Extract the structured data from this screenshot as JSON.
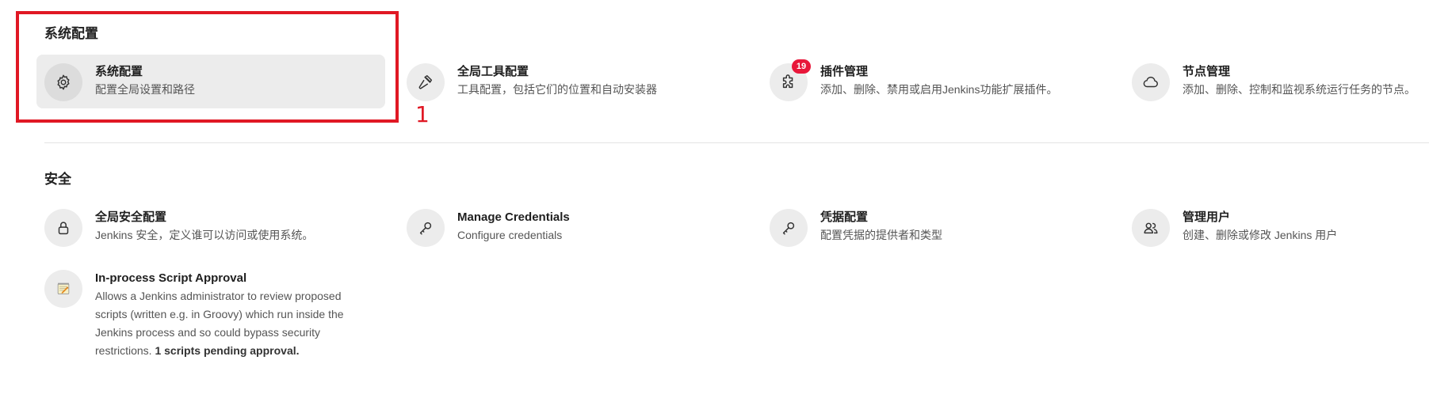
{
  "sections": {
    "system": {
      "title": "系统配置"
    },
    "security": {
      "title": "安全"
    }
  },
  "items": {
    "system_config": {
      "title": "系统配置",
      "desc": "配置全局设置和路径",
      "icon": "gear-icon"
    },
    "global_tools": {
      "title": "全局工具配置",
      "desc": "工具配置，包括它们的位置和自动安装器",
      "icon": "hammer-icon"
    },
    "plugins": {
      "title": "插件管理",
      "desc": "添加、删除、禁用或启用Jenkins功能扩展插件。",
      "icon": "puzzle-icon",
      "badge": "19"
    },
    "nodes": {
      "title": "节点管理",
      "desc": "添加、删除、控制和监视系统运行任务的节点。",
      "icon": "cloud-icon"
    },
    "global_security": {
      "title": "全局安全配置",
      "desc": "Jenkins 安全，定义谁可以访问或使用系统。",
      "icon": "lock-icon"
    },
    "manage_credentials": {
      "title": "Manage Credentials",
      "desc": "Configure credentials",
      "icon": "key-icon"
    },
    "credential_config": {
      "title": "凭据配置",
      "desc": "配置凭据的提供者和类型",
      "icon": "key-icon"
    },
    "manage_users": {
      "title": "管理用户",
      "desc": "创建、删除或修改 Jenkins 用户",
      "icon": "users-icon"
    },
    "script_approval": {
      "title": "In-process Script Approval",
      "desc": "Allows a Jenkins administrator to review proposed scripts (written e.g. in Groovy) which run inside the Jenkins process and so could bypass security restrictions.",
      "desc_bold": " 1 scripts pending approval.",
      "icon": "notepad-icon"
    }
  },
  "annotation": {
    "marker": "1",
    "color": "#e01824"
  },
  "colors": {
    "badge": "#e8173a",
    "highlight_bg": "#ececec",
    "icon_bg": "#ececec"
  }
}
